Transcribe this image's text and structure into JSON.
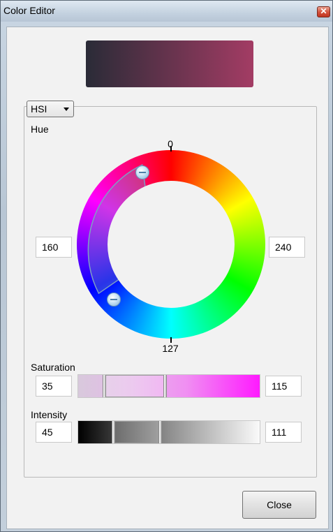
{
  "window": {
    "title": "Color Editor",
    "close_glyph": "✕"
  },
  "preview": {
    "gradient_from": "#2a2b37",
    "gradient_to": "#a33c64"
  },
  "mode": {
    "selected": "HSI"
  },
  "hue": {
    "label": "Hue",
    "tick_top": "0",
    "tick_bottom": "127",
    "left_value": "160",
    "right_value": "240"
  },
  "saturation": {
    "label": "Saturation",
    "min_value": "35",
    "max_value": "115"
  },
  "intensity": {
    "label": "Intensity",
    "min_value": "45",
    "max_value": "111"
  },
  "footer": {
    "close_label": "Close"
  }
}
